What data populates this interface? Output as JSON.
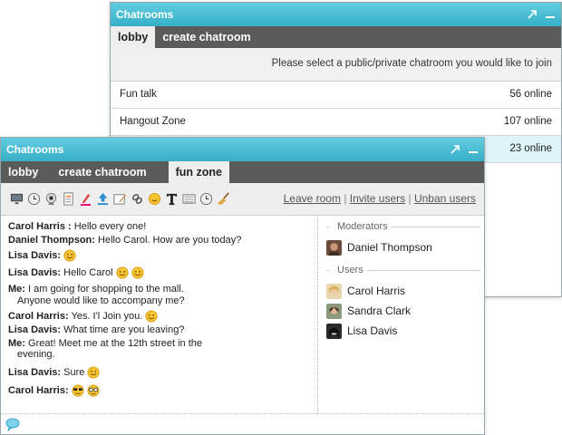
{
  "back_window": {
    "title": "Chatrooms",
    "tabs": [
      "lobby",
      "create chatroom"
    ],
    "prompt": "Please select a public/private chatroom you would like to join",
    "rooms": [
      {
        "name": "Fun talk",
        "online": "56 online"
      },
      {
        "name": "Hangout Zone",
        "online": "107 online"
      },
      {
        "name": "",
        "online": "23 online"
      }
    ]
  },
  "front_window": {
    "title": "Chatrooms",
    "tabs": [
      "lobby",
      "create chatroom",
      "fun zone"
    ],
    "toolbar_links": {
      "leave": "Leave room",
      "invite": "Invite users",
      "unban": "Unban users",
      "separator": "|"
    },
    "messages": [
      {
        "name": "Carol Harris :",
        "text": "Hello every one!"
      },
      {
        "name": "Daniel Thompson:",
        "text": "Hello Carol. How are you today?"
      },
      {
        "name": "Lisa Davis:",
        "text": ""
      },
      {
        "name": "Lisa Davis:",
        "text": "Hello Carol"
      },
      {
        "name": "Me:",
        "text": "I am going for shopping to the mall.",
        "cont": "Anyone would like to accompany me?"
      },
      {
        "name": "Carol Harris:",
        "text": "Yes. I'l Join you."
      },
      {
        "name": "Lisa Davis:",
        "text": "What time are you leaving?"
      },
      {
        "name": "Me:",
        "text": "Great! Meet me at the 12th street in the",
        "cont": "evening."
      },
      {
        "name": "Lisa Davis:",
        "text": "Sure"
      },
      {
        "name": "Carol Harris:",
        "text": ""
      }
    ],
    "moderators_label": "Moderators",
    "moderators": [
      "Daniel Thompson"
    ],
    "users_label": "Users",
    "users": [
      "Carol Harris",
      "Sandra Clark",
      "Lisa Davis"
    ]
  },
  "colors": {
    "titlebar": "#36afc7",
    "tabbar": "#5b5b5b",
    "selected_room": "#def4fb"
  }
}
